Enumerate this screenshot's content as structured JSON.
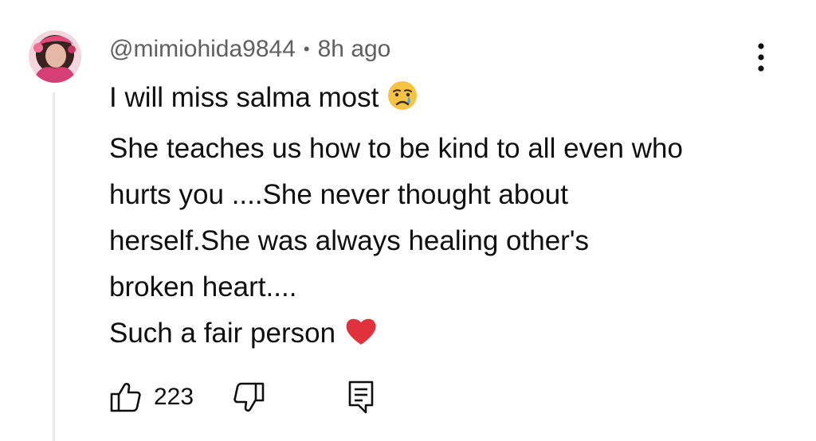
{
  "comment": {
    "author": "@mimiohida9844",
    "separator": "•",
    "time": "8h ago",
    "lines": [
      "I will miss salma most",
      "She teaches us how to be kind to all even who",
      "hurts you ....She never thought about",
      "herself.She was always healing other's",
      "broken heart....",
      "Such a fair person"
    ],
    "line1_emoji": "crying-face-emoji",
    "last_line_emoji": "red-heart-emoji",
    "like_count": "223"
  },
  "icons": {
    "like": "thumbs-up-icon",
    "dislike": "thumbs-down-icon",
    "reply": "reply-comment-icon",
    "more": "more-vertical-icon"
  },
  "colors": {
    "text": "#0f0f0f",
    "meta": "#606060",
    "thread_line": "#e9e9e9",
    "heart": "#e0323d",
    "emoji_face": "#f6c343"
  }
}
